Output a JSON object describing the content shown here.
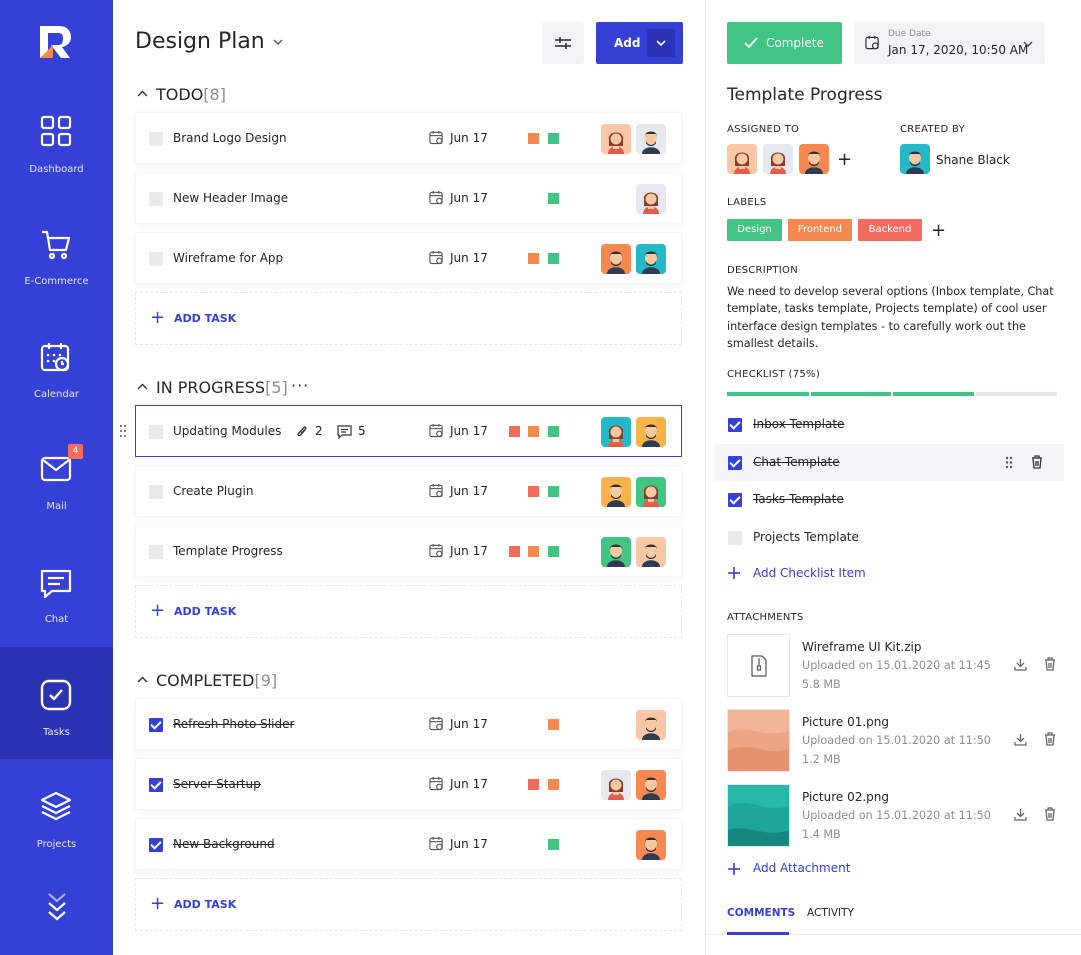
{
  "sidebar": {
    "items": [
      {
        "label": "Dashboard",
        "icon": "dashboard-icon"
      },
      {
        "label": "E-Commerce",
        "icon": "cart-icon"
      },
      {
        "label": "Calendar",
        "icon": "calendar-icon"
      },
      {
        "label": "Mail",
        "icon": "mail-icon",
        "badge": "4"
      },
      {
        "label": "Chat",
        "icon": "chat-icon"
      },
      {
        "label": "Tasks",
        "icon": "tasks-icon",
        "active": true
      },
      {
        "label": "Projects",
        "icon": "layers-icon"
      }
    ]
  },
  "board": {
    "title": "Design Plan",
    "add_label": "Add",
    "add_task_label": "ADD TASK",
    "sections": [
      {
        "name": "TODO",
        "count": "[8]",
        "tasks": [
          {
            "name": "Brand Logo Design",
            "date": "Jun 17",
            "labels": [
              "#f5894f",
              "#42c583"
            ],
            "avatars": [
              "woman-avatar",
              "man-avatar"
            ]
          },
          {
            "name": "New Header Image",
            "date": "Jun 17",
            "labels": [
              "#42c583"
            ],
            "avatars": [
              "woman-avatar"
            ]
          },
          {
            "name": "Wireframe for App",
            "date": "Jun 17",
            "labels": [
              "#f5894f",
              "#42c583"
            ],
            "avatars": [
              "man-avatar",
              "man-avatar"
            ]
          }
        ]
      },
      {
        "name": "IN PROGRESS",
        "count": "[5]",
        "tasks": [
          {
            "name": "Updating Modules",
            "attachments": "2",
            "comments": "5",
            "date": "Jun 17",
            "labels": [
              "#f46c5e",
              "#f5894f",
              "#42c583"
            ],
            "avatars": [
              "woman-avatar",
              "man-avatar"
            ]
          },
          {
            "name": "Create Plugin",
            "date": "Jun 17",
            "labels": [
              "#f46c5e",
              "#42c583"
            ],
            "avatars": [
              "man-avatar",
              "woman-avatar"
            ]
          },
          {
            "name": "Template Progress",
            "date": "Jun 17",
            "labels": [
              "#f46c5e",
              "#f5894f",
              "#42c583"
            ],
            "avatars": [
              "man-avatar",
              "man-avatar"
            ]
          }
        ]
      },
      {
        "name": "COMPLETED",
        "count": "[9]",
        "tasks": [
          {
            "name": "Refresh Photo Slider",
            "date": "Jun 17",
            "labels": [
              "#f5894f"
            ],
            "avatars": [
              "man-avatar"
            ],
            "done": true
          },
          {
            "name": "Server Startup",
            "date": "Jun 17",
            "labels": [
              "#f46c5e",
              "#f5894f"
            ],
            "avatars": [
              "woman-avatar",
              "man-avatar"
            ],
            "done": true
          },
          {
            "name": "New Background",
            "date": "Jun 17",
            "labels": [
              "#42c583"
            ],
            "avatars": [
              "man-avatar"
            ],
            "done": true
          }
        ]
      }
    ]
  },
  "detail": {
    "complete_label": "Complete",
    "due_label": "Due Date",
    "due_value": "Jan 17, 2020, 10:50 AM",
    "title": "Template Progress",
    "assigned_label": "ASSIGNED TO",
    "created_label": "CREATED BY",
    "creator": "Shane Black",
    "labels_caption": "LABELS",
    "labels": [
      {
        "text": "Design",
        "color": "#42c583"
      },
      {
        "text": "Frontend",
        "color": "#f5894f"
      },
      {
        "text": "Backend",
        "color": "#f46c5e"
      }
    ],
    "description_caption": "DESCRIPTION",
    "description": "We need to develop several options (Inbox template, Chat template, tasks template, Projects template) of cool user interface design templates - to carefully work out the smallest details.",
    "checklist_caption": "CHECKLIST (75%)",
    "checklist_progress": 0.75,
    "checklist": [
      {
        "text": "Inbox Template",
        "done": true
      },
      {
        "text": "Chat Template",
        "done": true
      },
      {
        "text": "Tasks Template",
        "done": true
      },
      {
        "text": "Projects Template",
        "done": false
      }
    ],
    "add_checklist": "Add Checklist Item",
    "attachments_caption": "ATTACHMENTS",
    "attachments": [
      {
        "name": "Wireframe UI Kit.zip",
        "uploaded": "Uploaded on 15.01.2020 at 11:45",
        "size": "5.8 MB",
        "thumb": "zip-file-icon"
      },
      {
        "name": "Picture 01.png",
        "uploaded": "Uploaded on 15.01.2020 at 11:50",
        "size": "1.2 MB",
        "thumb": "desert-image"
      },
      {
        "name": "Picture 02.png",
        "uploaded": "Uploaded on 15.01.2020 at 11:50",
        "size": "1.4 MB",
        "thumb": "sea-image"
      }
    ],
    "add_attachment": "Add Attachment",
    "tabs": [
      "COMMENTS",
      "ACTIVITY"
    ]
  },
  "colors": {
    "primary": "#3540d6",
    "sidebar_active": "#2a33b4",
    "green": "#42c583",
    "orange": "#f5894f",
    "red": "#f46c5e"
  }
}
